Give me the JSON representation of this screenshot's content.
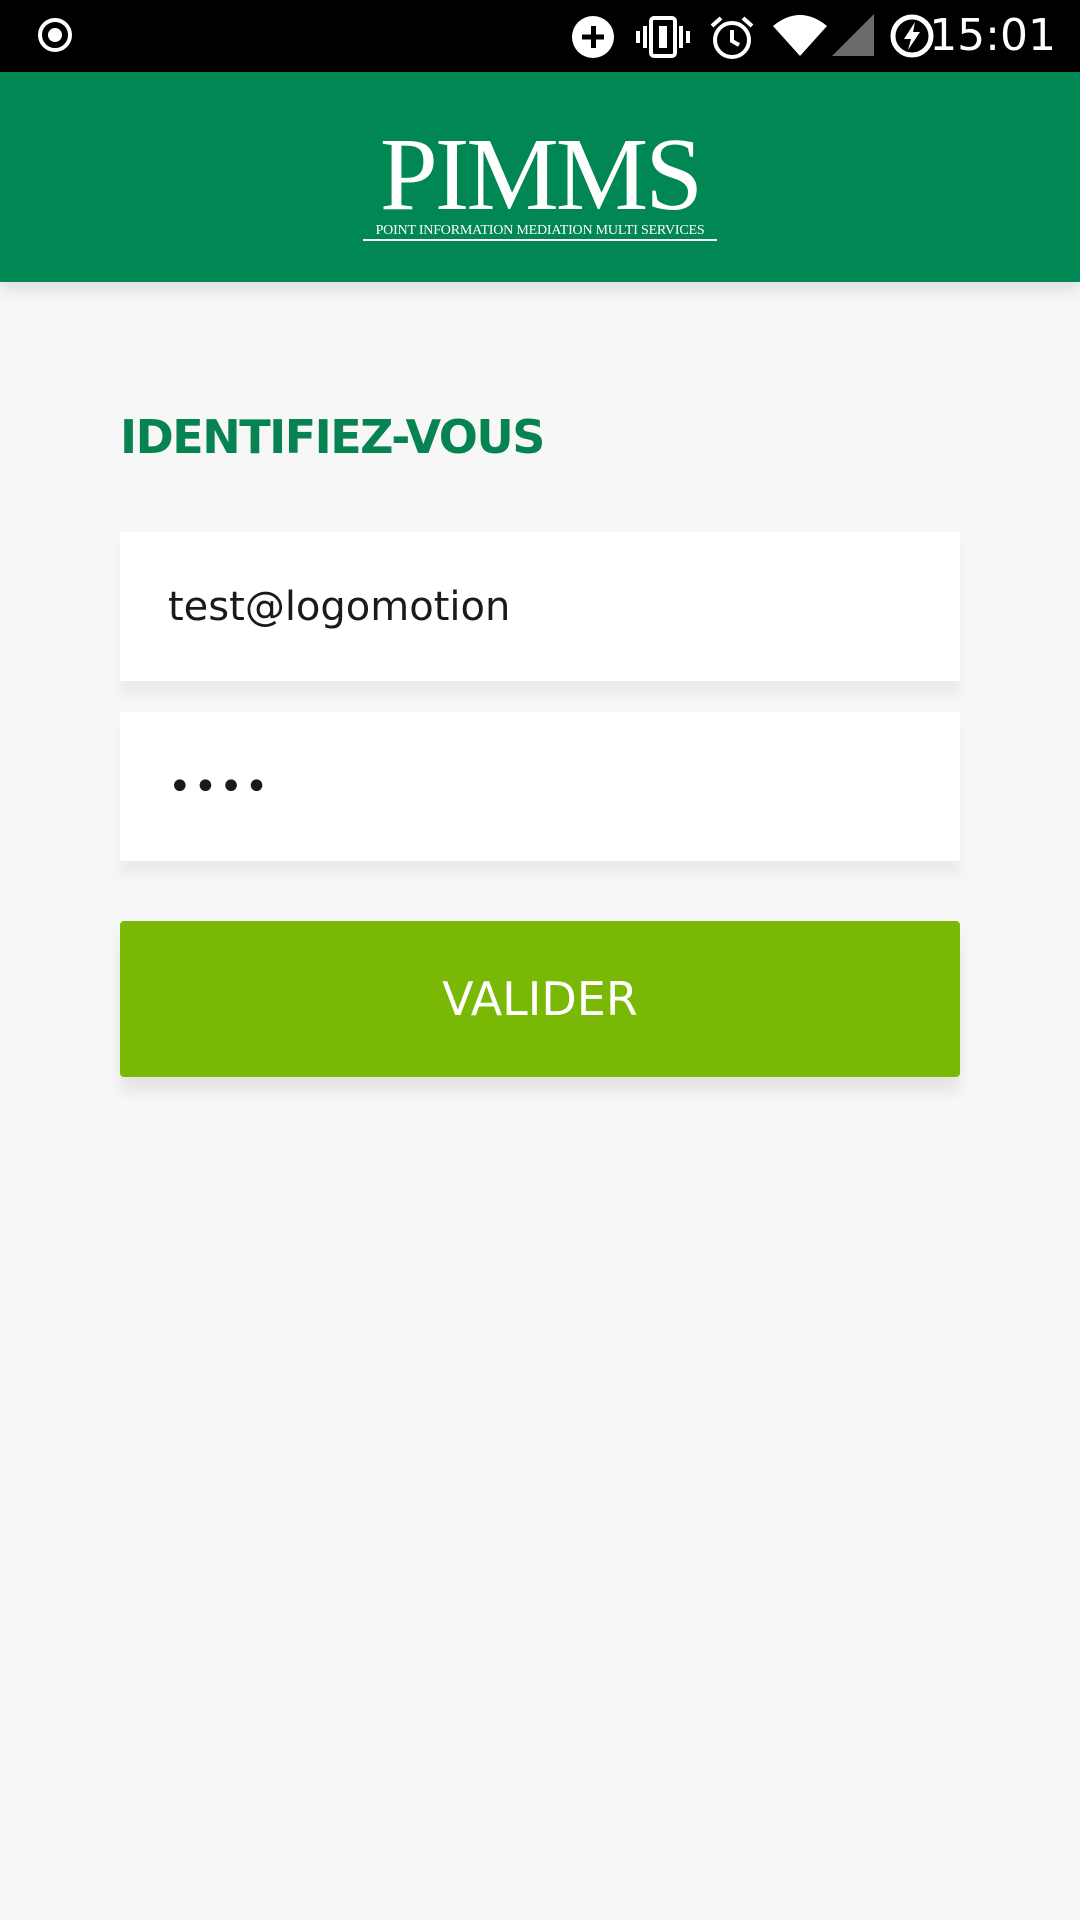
{
  "status_bar": {
    "time": "15:01",
    "icons": [
      "record-icon",
      "data-saver-icon",
      "vibrate-icon",
      "alarm-icon",
      "wifi-icon",
      "cell-signal-icon",
      "battery-charging-icon"
    ]
  },
  "header": {
    "logo_title": "PIMMS",
    "logo_subtitle": "POINT INFORMATION MEDIATION MULTI SERVICES",
    "background_color": "#008753"
  },
  "login": {
    "title": "IDENTIFIEZ-VOUS",
    "title_color": "#078352",
    "email_value": "test@logomotion",
    "password_value": "••••",
    "submit_label": "VALIDER",
    "submit_color": "#79b905"
  }
}
